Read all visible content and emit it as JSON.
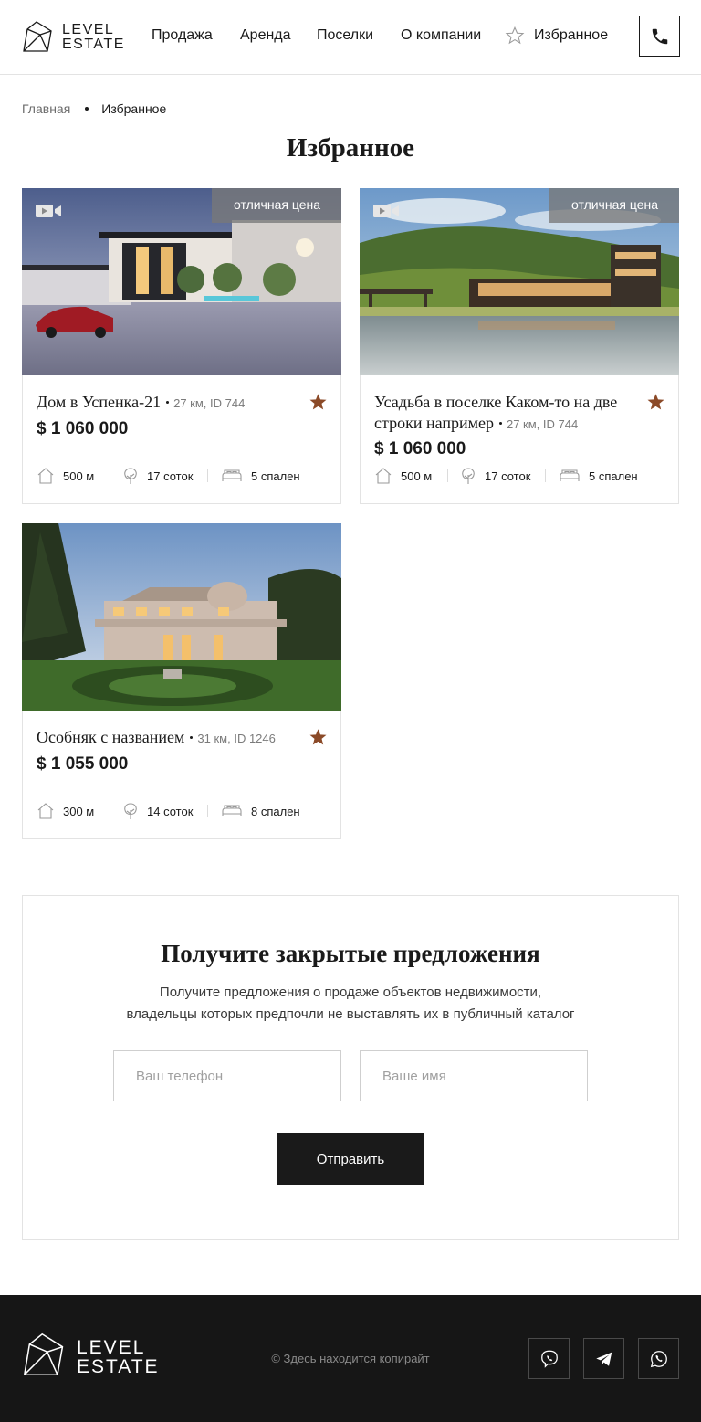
{
  "brand": {
    "logo_line1": "LEVEL",
    "logo_line2": "ESTATE"
  },
  "nav": {
    "items": [
      "Продажа",
      "Аренда",
      "Поселки",
      "О компании"
    ],
    "favorites": "Избранное"
  },
  "breadcrumb": {
    "home": "Главная",
    "current": "Избранное"
  },
  "page_title": "Избранное",
  "listings": [
    {
      "badge": "отличная цена",
      "has_video": true,
      "title": "Дом в Успенка-21",
      "meta": "27 км, ID 744",
      "price": "$ 1 060 000",
      "features": {
        "house": "500 м",
        "land": "17 соток",
        "bedrooms": "5 спален"
      },
      "favorited": true
    },
    {
      "badge": "отличная цена",
      "has_video": true,
      "title": "Усадьба в поселке Каком-то на две строки например",
      "meta": "27 км, ID 744",
      "price": "$ 1 060 000",
      "features": {
        "house": "500 м",
        "land": "17 соток",
        "bedrooms": "5 спален"
      },
      "favorited": true
    },
    {
      "badge": "",
      "has_video": false,
      "title": "Особняк с названием",
      "meta": "31 км, ID 1246",
      "price": "$ 1 055 000",
      "features": {
        "house": "300 м",
        "land": "14 соток",
        "bedrooms": "8 спален"
      },
      "favorited": true
    }
  ],
  "subscribe": {
    "title": "Получите закрытые предложения",
    "text_line1": "Получите предложения о продаже объектов недвижимости,",
    "text_line2": "владельцы которых предпочли не выставлять их в публичный каталог",
    "phone_placeholder": "Ваш телефон",
    "name_placeholder": "Ваше имя",
    "submit": "Отправить"
  },
  "footer": {
    "copyright": "© Здесь находится копирайт",
    "social": [
      "viber-icon",
      "telegram-icon",
      "whatsapp-icon"
    ]
  },
  "colors": {
    "accent_star": "#8b4a28",
    "dark": "#1a1a1a",
    "footer_bg": "#161616",
    "badge_bg": "#787878"
  }
}
